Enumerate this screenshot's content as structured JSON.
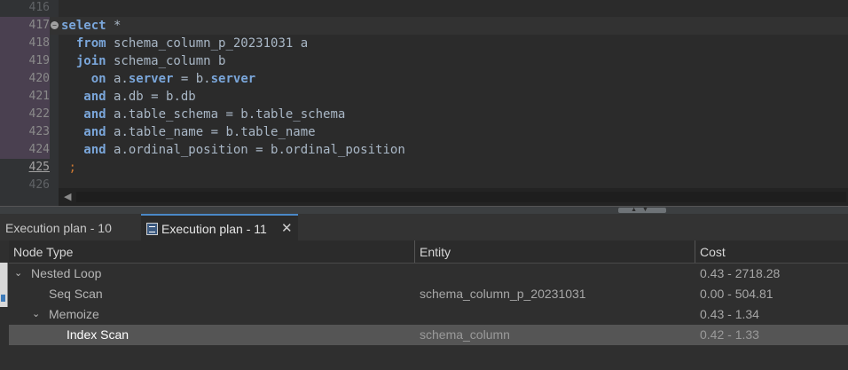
{
  "editor": {
    "lines": [
      {
        "num": "416",
        "tokens": []
      },
      {
        "num": "417",
        "tokens": [
          [
            "kw",
            "select"
          ],
          [
            "plain",
            " *"
          ]
        ]
      },
      {
        "num": "418",
        "tokens": [
          [
            "plain",
            "  "
          ],
          [
            "kw",
            "from"
          ],
          [
            "plain",
            " schema_column_p_20231031 a"
          ]
        ]
      },
      {
        "num": "419",
        "tokens": [
          [
            "plain",
            "  "
          ],
          [
            "kw",
            "join"
          ],
          [
            "plain",
            " schema_column b"
          ]
        ]
      },
      {
        "num": "420",
        "tokens": [
          [
            "plain",
            "    "
          ],
          [
            "kw",
            "on"
          ],
          [
            "plain",
            " a."
          ],
          [
            "fld",
            "server"
          ],
          [
            "plain",
            " = b."
          ],
          [
            "fld",
            "server"
          ]
        ]
      },
      {
        "num": "421",
        "tokens": [
          [
            "plain",
            "   "
          ],
          [
            "kw",
            "and"
          ],
          [
            "plain",
            " a.db = b.db"
          ]
        ]
      },
      {
        "num": "422",
        "tokens": [
          [
            "plain",
            "   "
          ],
          [
            "kw",
            "and"
          ],
          [
            "plain",
            " a.table_schema = b.table_schema"
          ]
        ]
      },
      {
        "num": "423",
        "tokens": [
          [
            "plain",
            "   "
          ],
          [
            "kw",
            "and"
          ],
          [
            "plain",
            " a.table_name = b.table_name"
          ]
        ]
      },
      {
        "num": "424",
        "tokens": [
          [
            "plain",
            "   "
          ],
          [
            "kw",
            "and"
          ],
          [
            "plain",
            " a.ordinal_position = b.ordinal_position"
          ]
        ]
      },
      {
        "num": "425",
        "tokens": [
          [
            "plain",
            " "
          ],
          [
            "semi",
            ";"
          ]
        ]
      },
      {
        "num": "426",
        "tokens": []
      }
    ]
  },
  "tabs": {
    "plan10_label": "Execution plan - 10",
    "plan11_label": "Execution plan - 11",
    "close_glyph": "✕"
  },
  "table": {
    "columns": [
      "Node Type",
      "Entity",
      "Cost"
    ],
    "rows": [
      {
        "indent": 0,
        "expand": "⌄",
        "node": "Nested Loop",
        "entity": "",
        "cost": "0.43 - 2718.28"
      },
      {
        "indent": 1,
        "expand": "",
        "node": "Seq Scan",
        "entity": "schema_column_p_20231031",
        "cost": "0.00 - 504.81"
      },
      {
        "indent": 1,
        "expand": "⌄",
        "node": "Memoize",
        "entity": "",
        "cost": "0.43 - 1.34"
      },
      {
        "indent": 2,
        "expand": "",
        "node": "Index Scan",
        "entity": "schema_column",
        "cost": "0.42 - 1.33",
        "selected": true
      }
    ]
  },
  "colors": {
    "keyword": "#7aa6da",
    "text": "#a9b7c6",
    "accent": "#4a88c7",
    "semicolon": "#cc7832"
  }
}
